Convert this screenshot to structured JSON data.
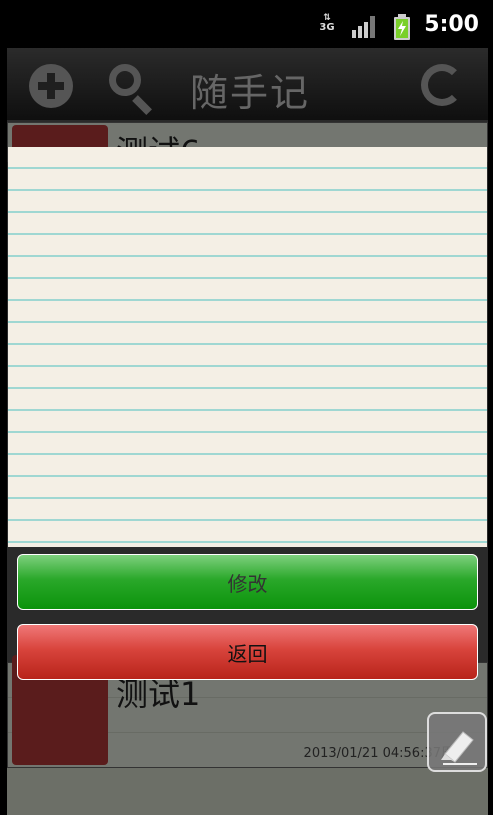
{
  "status_bar": {
    "network": "3G",
    "time": "5:00"
  },
  "title_bar": {
    "title": "随手记",
    "add_icon": "plus-circle-icon",
    "search_icon": "search-icon",
    "refresh_icon": "refresh-icon"
  },
  "notes": [
    {
      "title": "测试6"
    },
    {
      "title": "测试1",
      "date": "2013/01/21 04:56:37周"
    }
  ],
  "dialog": {
    "edit_label": "修改",
    "back_label": "返回"
  },
  "colors": {
    "edit_button": "#0b930b",
    "back_button": "#b8231a",
    "paper": "#f4efe5",
    "paper_lines": "#9fd7d2"
  },
  "fab": {
    "icon": "eraser-edit-icon"
  }
}
